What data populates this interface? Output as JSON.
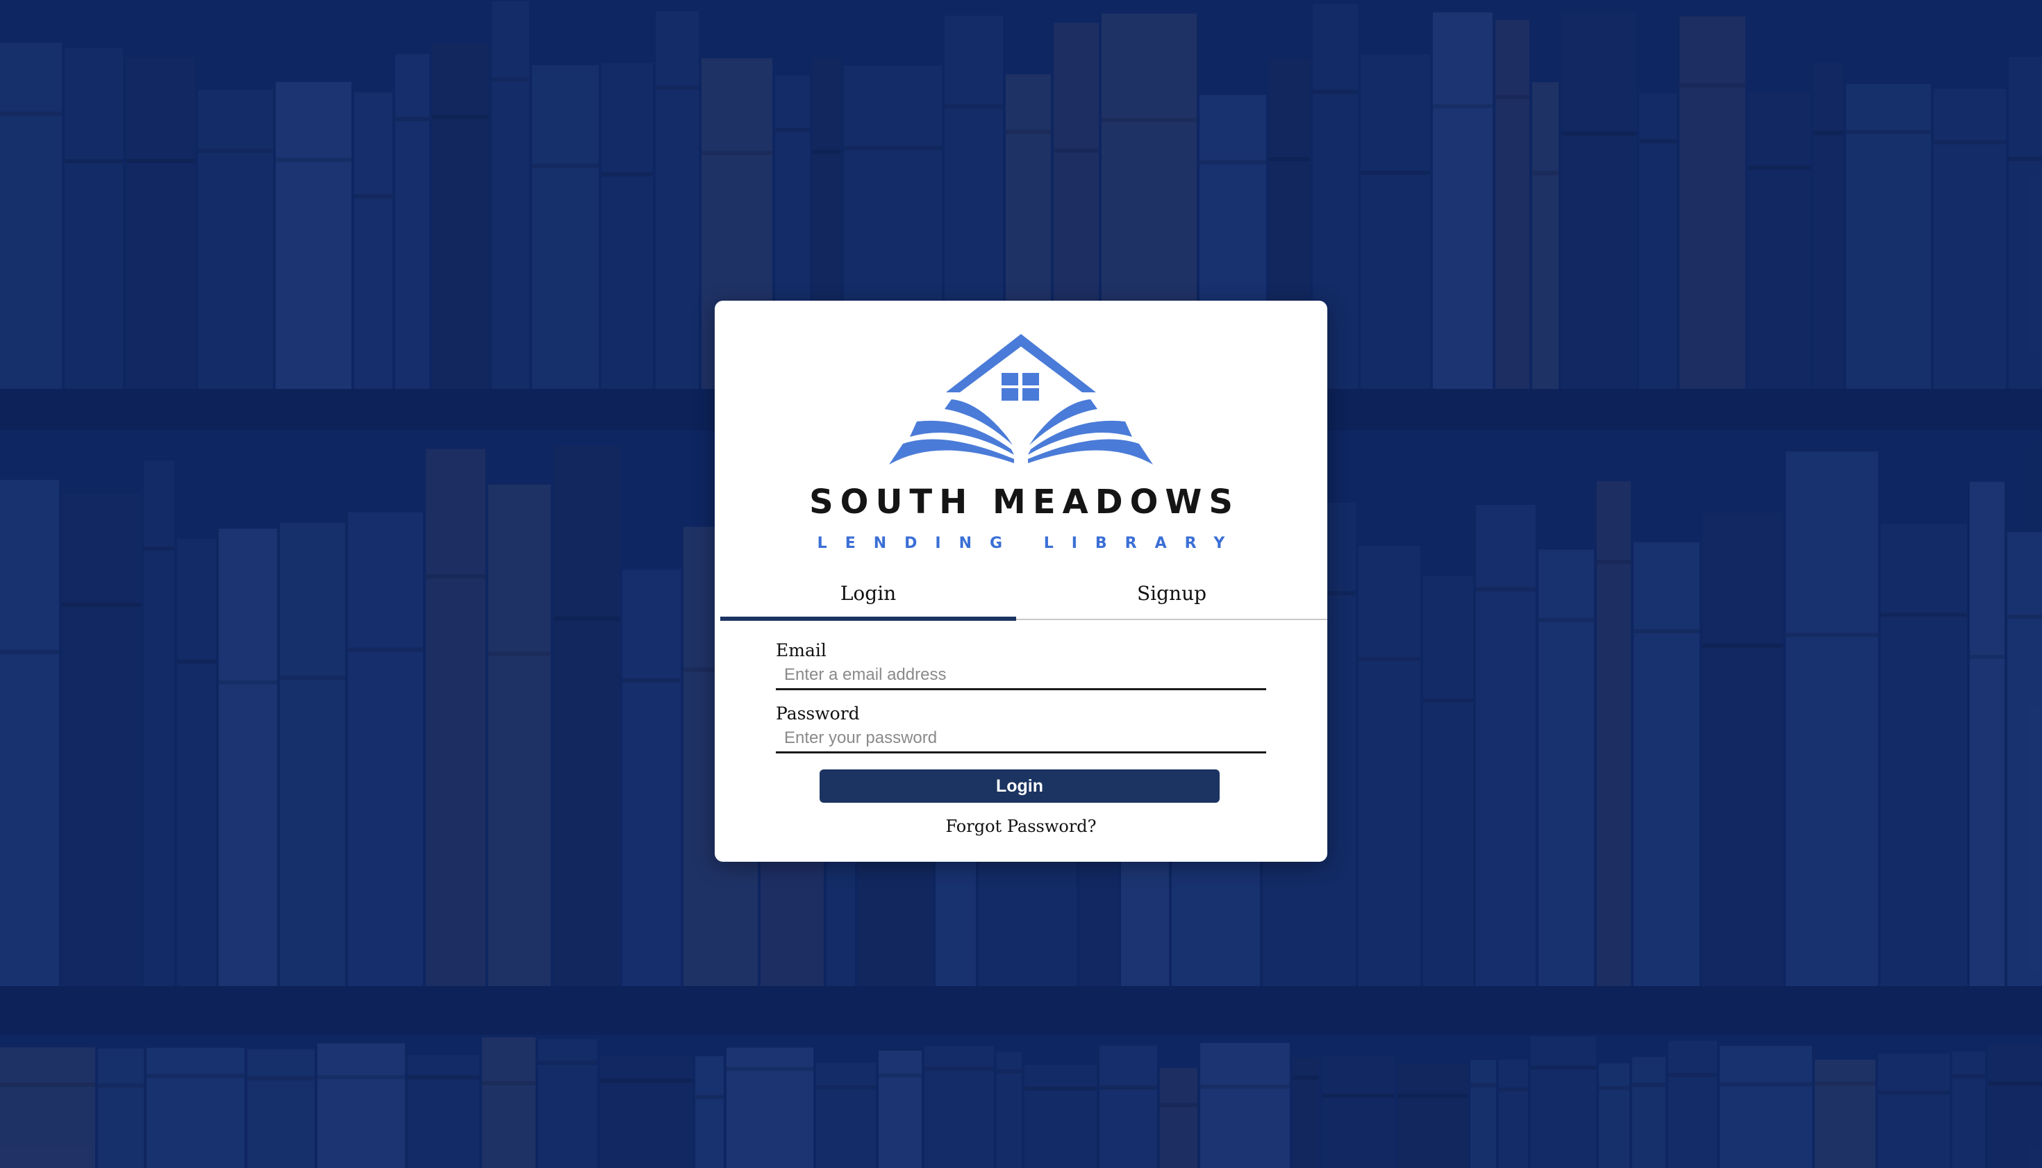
{
  "brand": {
    "title": "SOUTH MEADOWS",
    "subtitle": "LENDING LIBRARY",
    "logo_icon": "open-book-house-icon",
    "accent_color": "#3b6fd6"
  },
  "tabs": {
    "items": [
      {
        "label": "Login",
        "active": true
      },
      {
        "label": "Signup",
        "active": false
      }
    ],
    "active_color": "#1c3461"
  },
  "form": {
    "email": {
      "label": "Email",
      "placeholder": "Enter a email address",
      "value": ""
    },
    "password": {
      "label": "Password",
      "placeholder": "Enter your password",
      "value": ""
    },
    "submit_label": "Login",
    "forgot_label": "Forgot Password?"
  },
  "background": {
    "description_icon": "bookshelf-background",
    "tint_color": "#0f2660"
  }
}
